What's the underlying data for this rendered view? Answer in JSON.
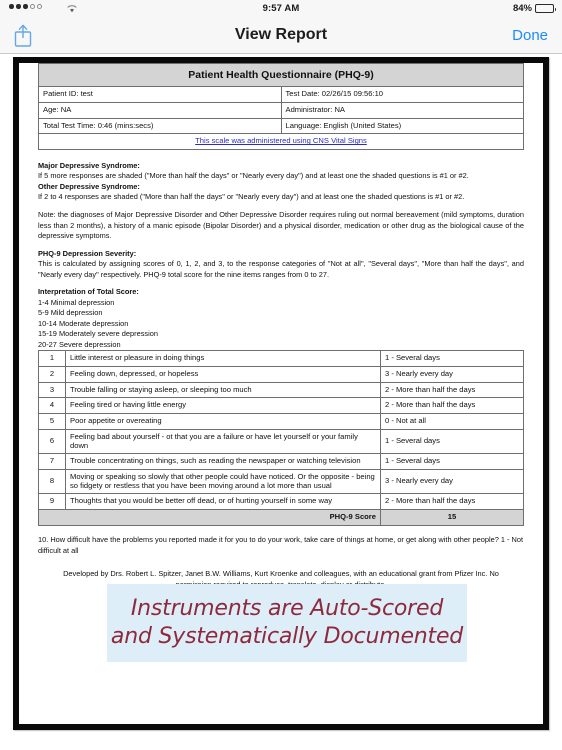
{
  "statusbar": {
    "signal_dots_filled": 3,
    "signal_dots_empty": 2,
    "wifi_icon": "wifi-icon",
    "time": "9:57 AM",
    "battery_percent": "84%",
    "battery_level": 84
  },
  "navbar": {
    "share_icon": "share-icon",
    "title": "View Report",
    "done_label": "Done"
  },
  "report": {
    "title": "Patient Health Questionnaire (PHQ-9)",
    "info": {
      "patient_id": "Patient ID: test",
      "test_date": "Test Date: 02/26/15 09:56:10",
      "age": "Age: NA",
      "administrator": "Administrator: NA",
      "total_test_time": "Total Test Time: 0:46 (mins:secs)",
      "language": "Language: English (United States)",
      "scale_link": "This scale was administered using CNS Vital Signs"
    },
    "criteria": {
      "major_heading": "Major Depressive Syndrome:",
      "major_text": "If 5 more responses are shaded (\"More than half the days\" or \"Nearly every day\") and at least one the shaded questions is #1 or #2.",
      "other_heading": "Other Depressive Syndrome:",
      "other_text": "If 2 to 4 responses are shaded (\"More than half the days\" or \"Nearly every day\") and at least one the shaded questions is #1 or #2.",
      "note_text": "Note: the diagnoses of Major Depressive Disorder and Other Depressive Disorder requires ruling out normal bereavement (mild symptoms, duration less than 2 months), a history of a manic episode (Bipolar Disorder) and a physical disorder, medication or other drug as the biological cause of the depressive symptoms."
    },
    "severity": {
      "heading": "PHQ-9 Depression Severity:",
      "text": "This is calculated by assigning scores of 0, 1, 2, and 3, to the response categories of \"Not at all\", \"Several days\", \"More than half the days\", and \"Nearly every day\" respectively. PHQ-9 total score for the nine items ranges from 0 to 27."
    },
    "interpretation": {
      "heading": "Interpretation of Total Score:",
      "ranges": [
        "1-4 Minimal depression",
        "5-9 Mild depression",
        "10-14 Moderate depression",
        "15-19 Moderately severe depression",
        "20-27 Severe depression"
      ]
    },
    "questions": [
      {
        "num": "1",
        "text": "Little interest or pleasure in doing things",
        "answer": "1 - Several days"
      },
      {
        "num": "2",
        "text": "Feeling down, depressed, or hopeless",
        "answer": "3 - Nearly every day"
      },
      {
        "num": "3",
        "text": "Trouble falling or staying asleep, or sleeping too much",
        "answer": "2 - More than half the days"
      },
      {
        "num": "4",
        "text": "Feeling tired or having little energy",
        "answer": "2 - More than half the days"
      },
      {
        "num": "5",
        "text": "Poor appetite or overeating",
        "answer": "0 - Not at all"
      },
      {
        "num": "6",
        "text": "Feeling bad about yourself - ot that you are a failure or have let yourself or your family down",
        "answer": "1 - Several days"
      },
      {
        "num": "7",
        "text": "Trouble concentrating on things, such as reading the newspaper or watching television",
        "answer": "1 - Several days"
      },
      {
        "num": "8",
        "text": "Moving or speaking so slowly that other people could have noticed. Or the opposite - being so fidgety or restless that you have been moving around a lot more than usual",
        "answer": "3 - Nearly every day"
      },
      {
        "num": "9",
        "text": "Thoughts that you would be better off dead, or of hurting yourself in some way",
        "answer": "2 - More than half the days"
      }
    ],
    "score_label": "PHQ-9 Score",
    "score_value": "15",
    "question10": "10. How difficult have the problems you reported made it for you to do your work, take care of things at home, or get along with other people? 1 - Not difficult at all",
    "credit": "Developed by Drs. Robert L. Spitzer, Janet B.W. Williams, Kurt Kroenke and colleagues, with an educational grant from Pfizer Inc. No permission required to reproduce, translate, display or distribute."
  },
  "callout": {
    "line1": "Instruments are Auto-Scored",
    "line2": "and Systematically Documented",
    "background_color": "#ddeef8",
    "text_color": "#8e2a3c"
  },
  "colors": {
    "accent_blue": "#1a8cff",
    "link_blue": "#2b2bc8",
    "table_header_gray": "#d4d4d4",
    "chrome_gray": "#f7f7f7"
  }
}
